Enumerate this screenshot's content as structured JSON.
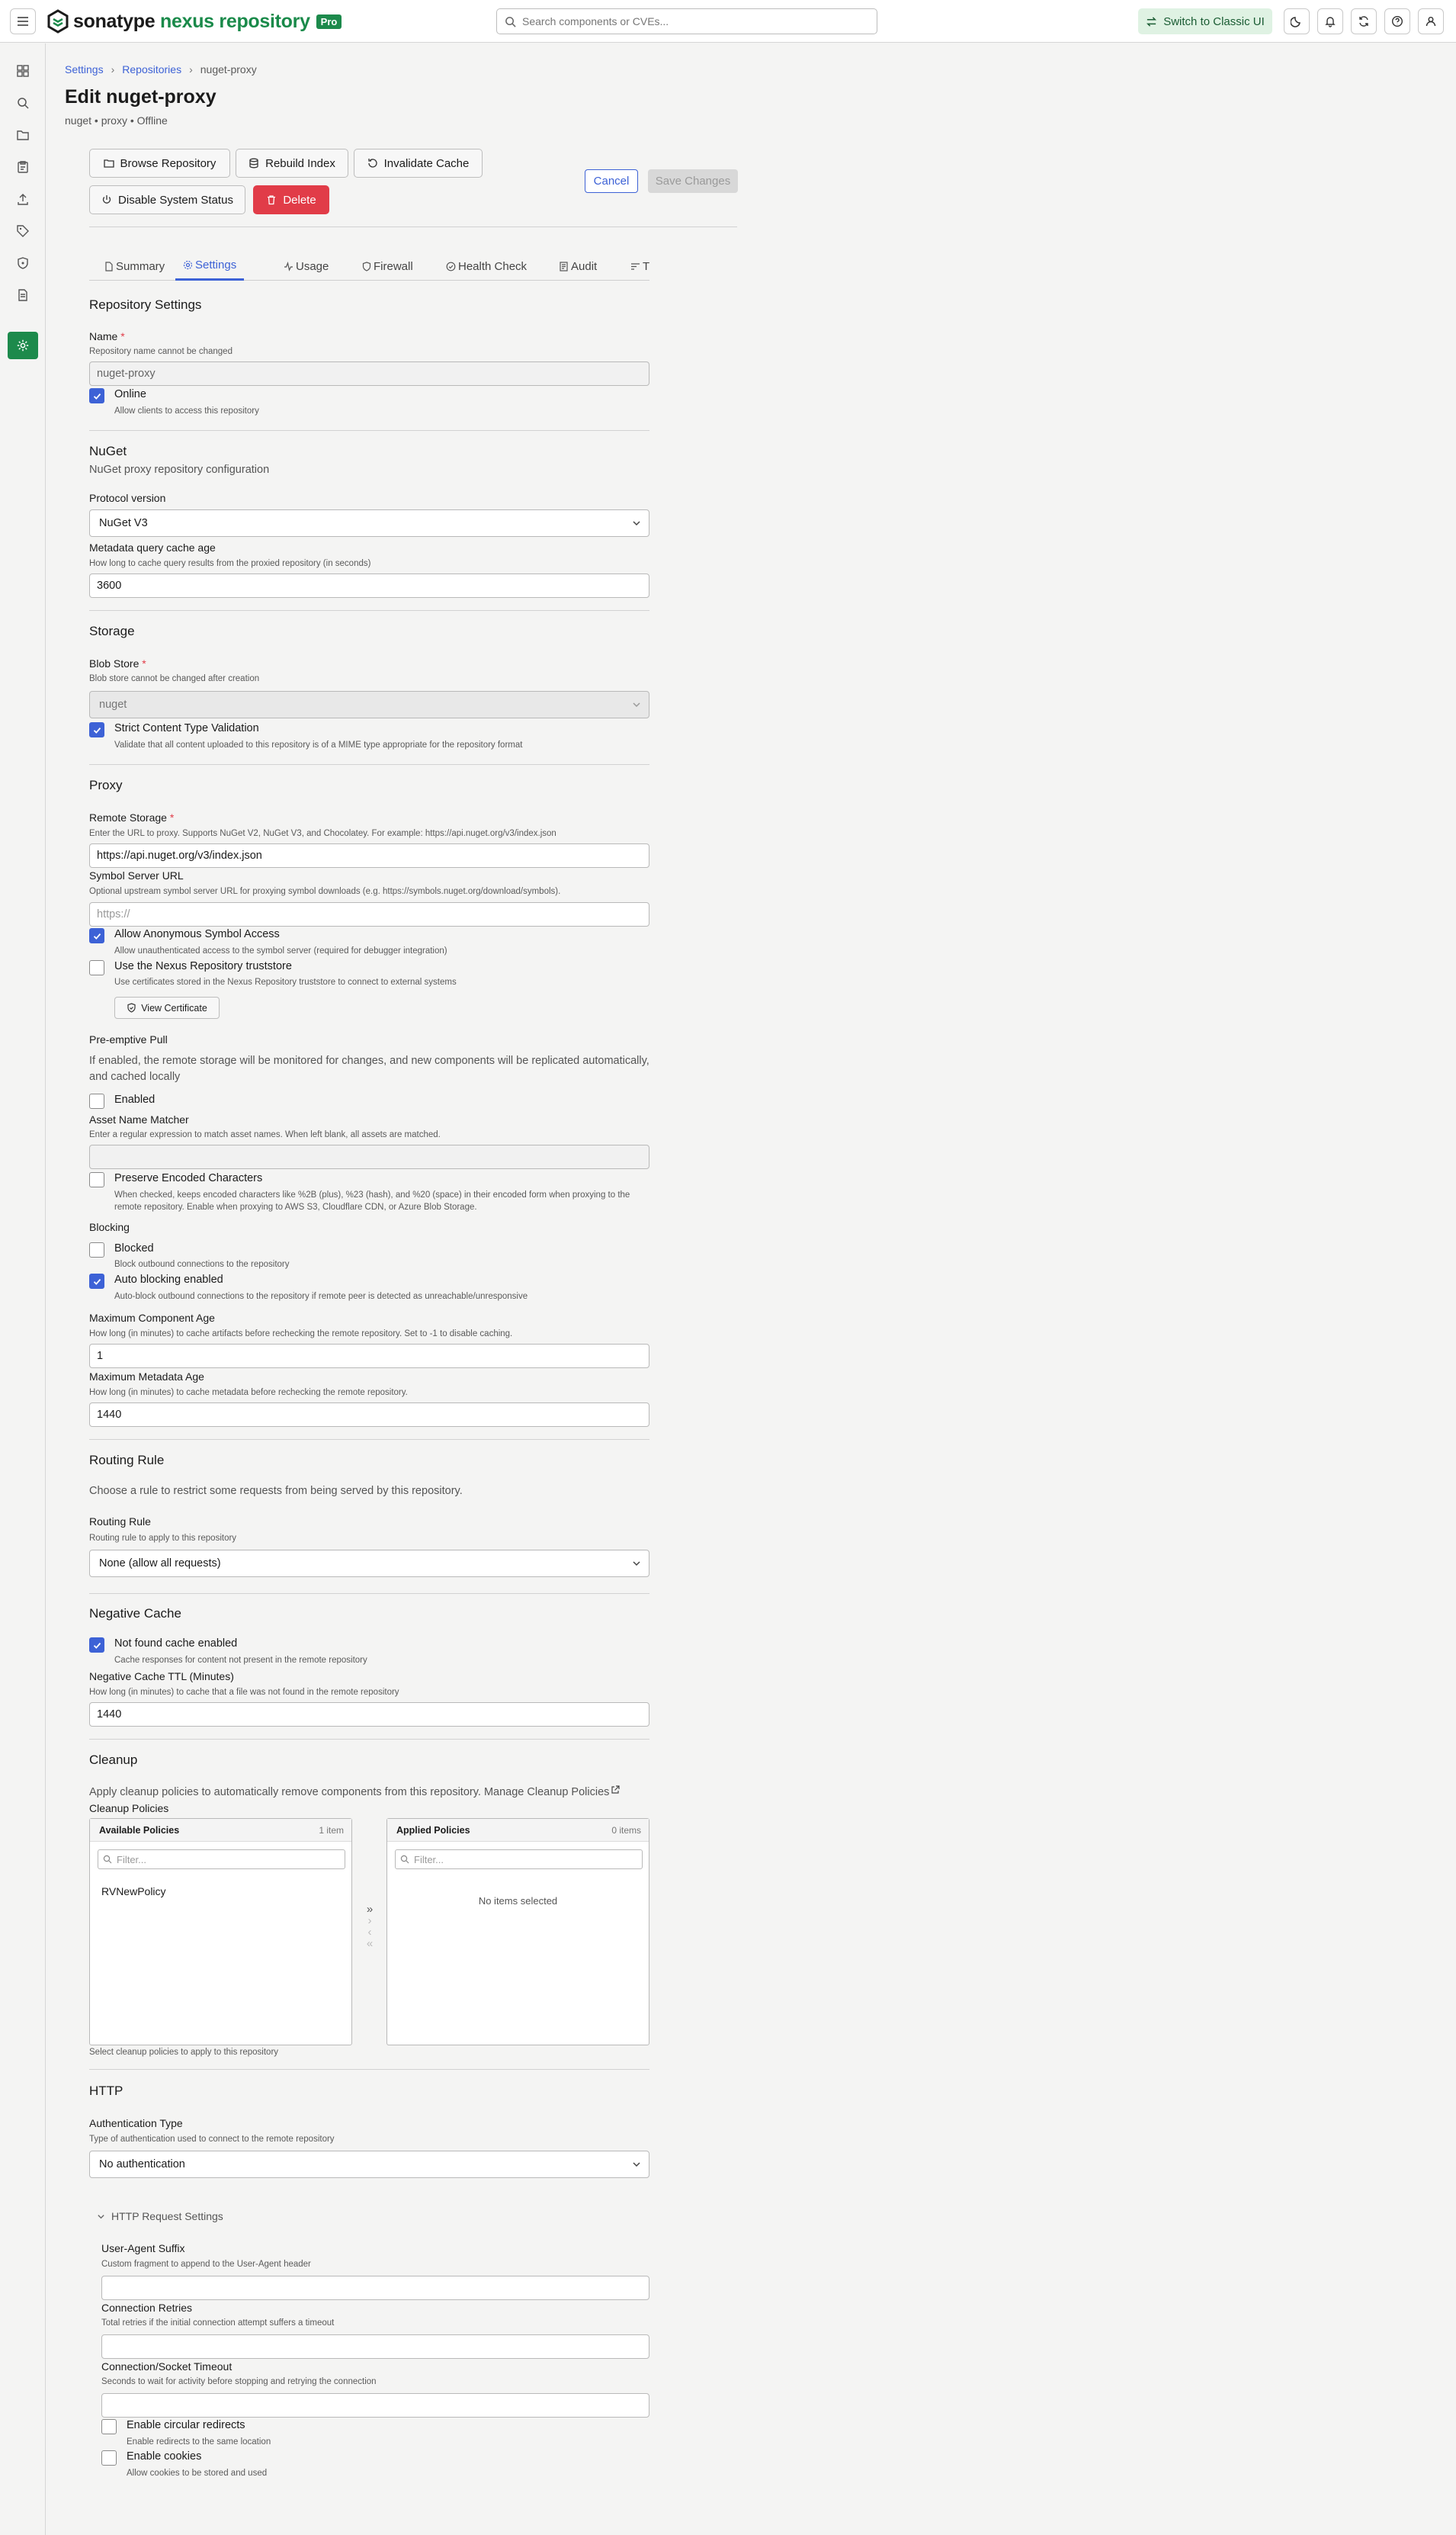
{
  "header": {
    "brand": "sonatype",
    "product": "nexus repository",
    "edition": "Pro",
    "search_placeholder": "Search components or CVEs...",
    "classic_label": "Switch to Classic UI"
  },
  "breadcrumb": {
    "settings": "Settings",
    "repositories": "Repositories",
    "current": "nuget-proxy"
  },
  "page": {
    "title": "Edit nuget-proxy",
    "subtitle": "nuget • proxy • Offline"
  },
  "actions": {
    "browse": "Browse Repository",
    "rebuild": "Rebuild Index",
    "invalidate": "Invalidate Cache",
    "disable_status": "Disable System Status",
    "delete": "Delete",
    "cancel": "Cancel",
    "save": "Save Changes"
  },
  "tabs": [
    "Summary",
    "Settings",
    "Usage",
    "Firewall",
    "Health Check",
    "Audit",
    "T"
  ],
  "repo_settings": {
    "heading": "Repository Settings",
    "name_label": "Name",
    "name_hint": "Repository name cannot be changed",
    "name_value": "nuget-proxy",
    "online_label": "Online",
    "online_hint": "Allow clients to access this repository"
  },
  "nuget": {
    "heading": "NuGet",
    "desc": "NuGet proxy repository configuration",
    "protocol_label": "Protocol version",
    "protocol_value": "NuGet V3",
    "meta_label": "Metadata query cache age",
    "meta_hint": "How long to cache query results from the proxied repository (in seconds)",
    "meta_value": "3600"
  },
  "storage": {
    "heading": "Storage",
    "blob_label": "Blob Store",
    "blob_hint": "Blob store cannot be changed after creation",
    "blob_value": "nuget",
    "strict_label": "Strict Content Type Validation",
    "strict_hint": "Validate that all content uploaded to this repository is of a MIME type appropriate for the repository format"
  },
  "proxy": {
    "heading": "Proxy",
    "remote_label": "Remote Storage",
    "remote_hint": "Enter the URL to proxy. Supports NuGet V2, NuGet V3, and Chocolatey. For example: https://api.nuget.org/v3/index.json",
    "remote_value": "https://api.nuget.org/v3/index.json",
    "symbol_label": "Symbol Server URL",
    "symbol_hint": "Optional upstream symbol server URL for proxying symbol downloads (e.g. https://symbols.nuget.org/download/symbols).",
    "symbol_placeholder": "https://",
    "anon_label": "Allow Anonymous Symbol Access",
    "anon_hint": "Allow unauthenticated access to the symbol server (required for debugger integration)",
    "trust_label": "Use the Nexus Repository truststore",
    "trust_hint": "Use certificates stored in the Nexus Repository truststore to connect to external systems",
    "cert_button": "View Certificate",
    "preemptive_heading": "Pre-emptive Pull",
    "preemptive_desc": "If enabled, the remote storage will be monitored for changes, and new components will be replicated automatically, and cached locally",
    "enabled_label": "Enabled",
    "matcher_label": "Asset Name Matcher",
    "matcher_hint": "Enter a regular expression to match asset names. When left blank, all assets are matched.",
    "preserve_label": "Preserve Encoded Characters",
    "preserve_hint": "When checked, keeps encoded characters like %2B (plus), %23 (hash), and %20 (space) in their encoded form when proxying to the remote repository. Enable when proxying to AWS S3, Cloudflare CDN, or Azure Blob Storage.",
    "blocking_heading": "Blocking",
    "blocked_label": "Blocked",
    "blocked_hint": "Block outbound connections to the repository",
    "autoblock_label": "Auto blocking enabled",
    "autoblock_hint": "Auto-block outbound connections to the repository if remote peer is detected as unreachable/unresponsive",
    "max_comp_label": "Maximum Component Age",
    "max_comp_hint": "How long (in minutes) to cache artifacts before rechecking the remote repository. Set to -1 to disable caching.",
    "max_comp_value": "1",
    "max_meta_label": "Maximum Metadata Age",
    "max_meta_hint": "How long (in minutes) to cache metadata before rechecking the remote repository.",
    "max_meta_value": "1440"
  },
  "routing": {
    "heading": "Routing Rule",
    "desc": "Choose a rule to restrict some requests from being served by this repository.",
    "label": "Routing Rule",
    "hint": "Routing rule to apply to this repository",
    "value": "None (allow all requests)"
  },
  "negative": {
    "heading": "Negative Cache",
    "nf_label": "Not found cache enabled",
    "nf_hint": "Cache responses for content not present in the remote repository",
    "ttl_label": "Negative Cache TTL (Minutes)",
    "ttl_hint": "How long (in minutes) to cache that a file was not found in the remote repository",
    "ttl_value": "1440"
  },
  "cleanup": {
    "heading": "Cleanup",
    "desc": "Apply cleanup policies to automatically remove components from this repository. Manage Cleanup Policies",
    "policies_label": "Cleanup Policies",
    "available_title": "Available Policies",
    "available_count": "1 item",
    "applied_title": "Applied Policies",
    "applied_count": "0 items",
    "filter_placeholder": "Filter...",
    "available_items": [
      "RVNewPolicy"
    ],
    "empty_text": "No items selected",
    "hint": "Select cleanup policies to apply to this repository"
  },
  "http": {
    "heading": "HTTP",
    "auth_label": "Authentication Type",
    "auth_hint": "Type of authentication used to connect to the remote repository",
    "auth_value": "No authentication",
    "request_settings": "HTTP Request Settings",
    "ua_label": "User-Agent Suffix",
    "ua_hint": "Custom fragment to append to the User-Agent header",
    "retries_label": "Connection Retries",
    "retries_hint": "Total retries if the initial connection attempt suffers a timeout",
    "timeout_label": "Connection/Socket Timeout",
    "timeout_hint": "Seconds to wait for activity before stopping and retrying the connection",
    "circular_label": "Enable circular redirects",
    "circular_hint": "Enable redirects to the same location",
    "cookies_label": "Enable cookies",
    "cookies_hint": "Allow cookies to be stored and used"
  },
  "colors": {
    "accent": "#3d62d6",
    "brand": "#1d8a4c",
    "danger": "#e13c48"
  }
}
